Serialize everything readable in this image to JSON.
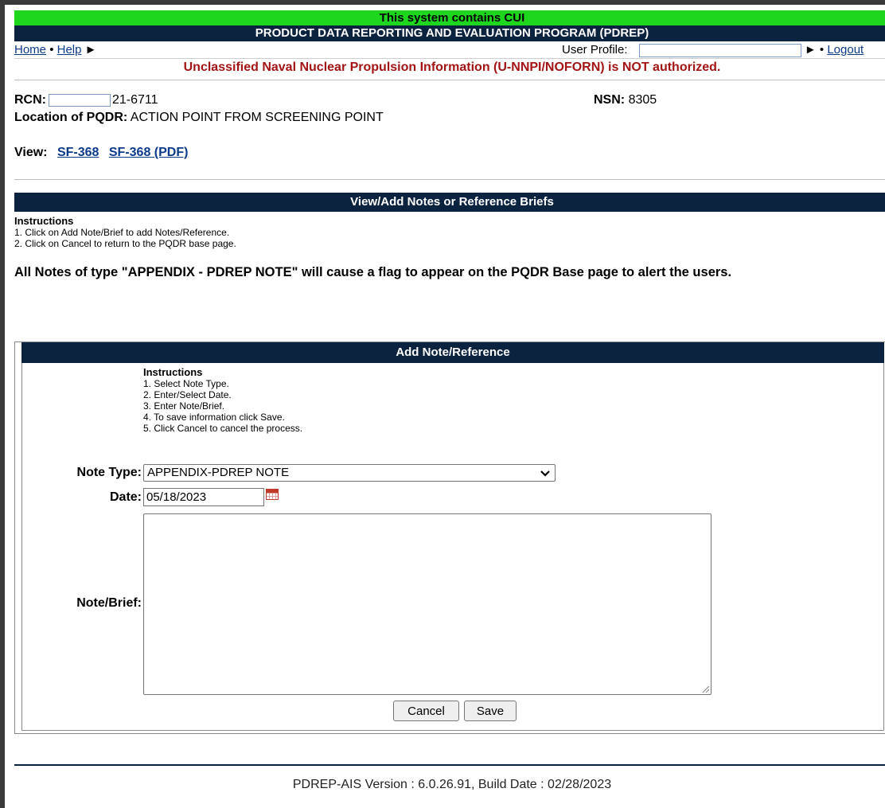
{
  "banner": {
    "cui": "This system contains CUI",
    "program": "PRODUCT DATA REPORTING AND EVALUATION PROGRAM (PDREP)"
  },
  "nav": {
    "home": "Home",
    "sep": "•",
    "help": "Help",
    "arrow": "►",
    "user_profile_label": "User Profile:",
    "user_profile_value": "",
    "logout": "Logout"
  },
  "warning": "Unclassified Naval Nuclear Propulsion Information (U-NNPI/NOFORN) is NOT authorized.",
  "record": {
    "rcn_label": "RCN:",
    "rcn_suffix": "21-6711",
    "nsn_label": "NSN:",
    "nsn_value": "8305",
    "location_label": "Location of PQDR:",
    "location_value": "ACTION POINT FROM SCREENING POINT",
    "view_label": "View:",
    "view_links": [
      "SF-368",
      "SF-368 (PDF)"
    ]
  },
  "notes_section": {
    "header": "View/Add Notes or Reference Briefs",
    "instr_title": "Instructions",
    "instr": [
      "1. Click on Add Note/Brief to add Notes/Reference.",
      "2. Click on Cancel to return to the PQDR base page."
    ],
    "notice": "All Notes of type \"APPENDIX - PDREP NOTE\" will cause a flag to appear on the PQDR Base page to alert the users."
  },
  "add_form": {
    "header": "Add Note/Reference",
    "instr_title": "Instructions",
    "instr": [
      "1. Select Note Type.",
      "2. Enter/Select Date.",
      "3. Enter Note/Brief.",
      "4. To save information click Save.",
      "5. Click Cancel to cancel the process."
    ],
    "note_type_label": "Note Type:",
    "note_type_value": "APPENDIX-PDREP NOTE",
    "date_label": "Date:",
    "date_value": "05/18/2023",
    "note_label": "Note/Brief:",
    "note_value": "",
    "cancel": "Cancel",
    "save": "Save"
  },
  "footer": "PDREP-AIS  Version : 6.0.26.91, Build Date : 02/28/2023"
}
